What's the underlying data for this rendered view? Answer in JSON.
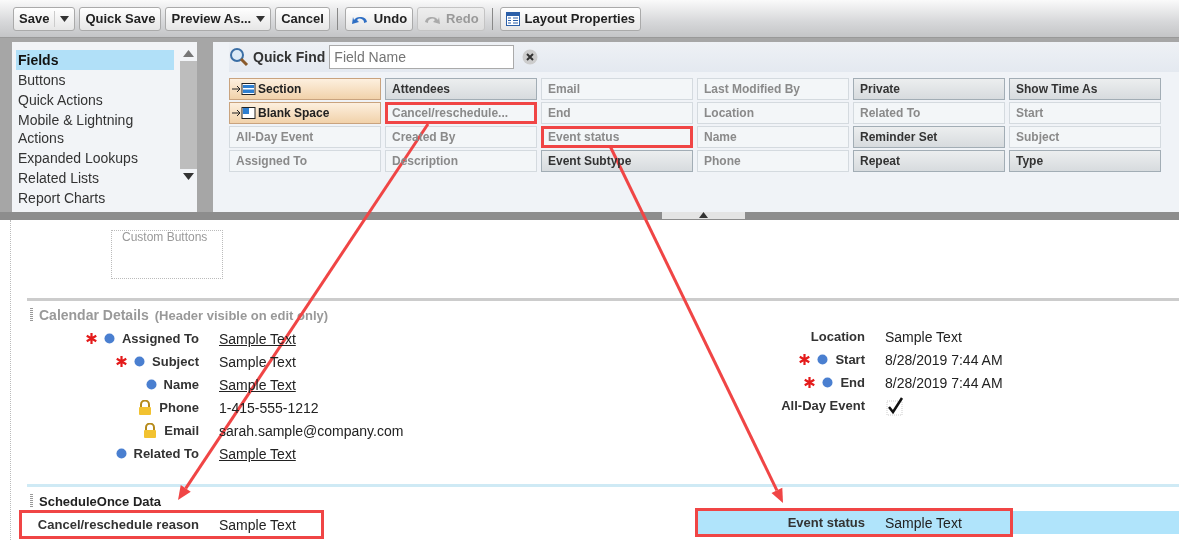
{
  "toolbar": [
    {
      "label": "Save",
      "kind": "split",
      "disabled": false
    },
    {
      "label": "Quick Save",
      "kind": "plain",
      "disabled": false
    },
    {
      "label": "Preview As...",
      "kind": "menu",
      "disabled": false
    },
    {
      "label": "Cancel",
      "kind": "plain",
      "disabled": false
    },
    {
      "kind": "separator"
    },
    {
      "label": "Undo",
      "kind": "undo",
      "disabled": false
    },
    {
      "label": "Redo",
      "kind": "redo",
      "disabled": true
    },
    {
      "kind": "separator"
    },
    {
      "label": "Layout Properties",
      "kind": "properties",
      "disabled": false
    }
  ],
  "palette": {
    "categories": [
      {
        "label": "Fields",
        "selected": true
      },
      {
        "label": "Buttons",
        "selected": false
      },
      {
        "label": "Quick Actions",
        "selected": false
      },
      {
        "label": "Mobile & Lightning Actions",
        "selected": false
      },
      {
        "label": "Expanded Lookups",
        "selected": false
      },
      {
        "label": "Related Lists",
        "selected": false
      },
      {
        "label": "Report Charts",
        "selected": false
      }
    ],
    "quick_find": {
      "label": "Quick Find",
      "placeholder": "Field Name"
    },
    "items": [
      {
        "label": "Section",
        "kind": "section",
        "highlighted": false
      },
      {
        "label": "Attendees",
        "kind": "field",
        "used": false,
        "highlighted": false
      },
      {
        "label": "Email",
        "kind": "field",
        "used": true,
        "highlighted": false
      },
      {
        "label": "Last Modified By",
        "kind": "field",
        "used": true,
        "highlighted": false
      },
      {
        "label": "Private",
        "kind": "field",
        "used": false,
        "highlighted": false
      },
      {
        "label": "Show Time As",
        "kind": "field",
        "used": false,
        "highlighted": false
      },
      {
        "label": "Blank Space",
        "kind": "blank",
        "highlighted": false
      },
      {
        "label": "Cancel/reschedule...",
        "kind": "field",
        "used": true,
        "highlighted": true
      },
      {
        "label": "End",
        "kind": "field",
        "used": true,
        "highlighted": false
      },
      {
        "label": "Location",
        "kind": "field",
        "used": true,
        "highlighted": false
      },
      {
        "label": "Related To",
        "kind": "field",
        "used": true,
        "highlighted": false
      },
      {
        "label": "Start",
        "kind": "field",
        "used": true,
        "highlighted": false
      },
      {
        "label": "All-Day Event",
        "kind": "field",
        "used": true,
        "highlighted": false
      },
      {
        "label": "Created By",
        "kind": "field",
        "used": true,
        "highlighted": false
      },
      {
        "label": "Event status",
        "kind": "field",
        "used": true,
        "highlighted": true
      },
      {
        "label": "Name",
        "kind": "field",
        "used": true,
        "highlighted": false
      },
      {
        "label": "Reminder Set",
        "kind": "field",
        "used": false,
        "highlighted": false
      },
      {
        "label": "Subject",
        "kind": "field",
        "used": true,
        "highlighted": false
      },
      {
        "label": "Assigned To",
        "kind": "field",
        "used": true,
        "highlighted": false
      },
      {
        "label": "Description",
        "kind": "field",
        "used": true,
        "highlighted": false
      },
      {
        "label": "Event Subtype",
        "kind": "field",
        "used": false,
        "highlighted": false
      },
      {
        "label": "Phone",
        "kind": "field",
        "used": true,
        "highlighted": false
      },
      {
        "label": "Repeat",
        "kind": "field",
        "used": false,
        "highlighted": false
      },
      {
        "label": "Type",
        "kind": "field",
        "used": false,
        "highlighted": false
      }
    ]
  },
  "custom_buttons": {
    "label": "Custom Buttons"
  },
  "sections": [
    {
      "title": "Calendar Details",
      "note": "(Header visible on edit only)",
      "header_visible": false,
      "columns": [
        [
          {
            "label": "Assigned To",
            "kind": "text",
            "value": "Sample Text",
            "required": true,
            "marked": true,
            "locked": false,
            "link": true,
            "highlighted": false,
            "selected": false
          },
          {
            "label": "Subject",
            "kind": "text",
            "value": "Sample Text",
            "required": true,
            "marked": true,
            "locked": false,
            "link": false,
            "highlighted": false,
            "selected": false
          },
          {
            "label": "Name",
            "kind": "text",
            "value": "Sample Text",
            "required": false,
            "marked": true,
            "locked": false,
            "link": true,
            "highlighted": false,
            "selected": false
          },
          {
            "label": "Phone",
            "kind": "text",
            "value": "1-415-555-1212",
            "required": false,
            "marked": false,
            "locked": true,
            "link": false,
            "highlighted": false,
            "selected": false
          },
          {
            "label": "Email",
            "kind": "text",
            "value": "sarah.sample@company.com",
            "required": false,
            "marked": false,
            "locked": true,
            "link": false,
            "highlighted": false,
            "selected": false
          },
          {
            "label": "Related To",
            "kind": "text",
            "value": "Sample Text",
            "required": false,
            "marked": true,
            "locked": false,
            "link": true,
            "highlighted": false,
            "selected": false
          }
        ],
        [
          {
            "label": "Location",
            "kind": "text",
            "value": "Sample Text",
            "required": false,
            "link": false,
            "highlighted": false,
            "selected": false
          },
          {
            "label": "Start",
            "kind": "text",
            "value": "8/28/2019 7:44 AM",
            "required": true,
            "marked": true,
            "locked": false,
            "link": false,
            "highlighted": false,
            "selected": false
          },
          {
            "label": "End",
            "kind": "text",
            "value": "8/28/2019 7:44 AM",
            "required": true,
            "marked": true,
            "locked": false,
            "link": false,
            "highlighted": false,
            "selected": false
          },
          {
            "label": "All-Day Event",
            "kind": "checkbox",
            "checked": true,
            "required": false,
            "highlighted": false,
            "selected": false
          }
        ]
      ]
    },
    {
      "title": "ScheduleOnce Data",
      "header_visible": true,
      "columns": [
        [
          {
            "label": "Cancel/reschedule reason",
            "kind": "text",
            "value": "Sample Text",
            "required": false,
            "link": false,
            "highlighted": true,
            "selected": false
          }
        ],
        [
          {
            "label": "Event status",
            "kind": "text",
            "value": "Sample Text",
            "required": false,
            "link": false,
            "highlighted": true,
            "selected": true
          }
        ]
      ]
    }
  ]
}
